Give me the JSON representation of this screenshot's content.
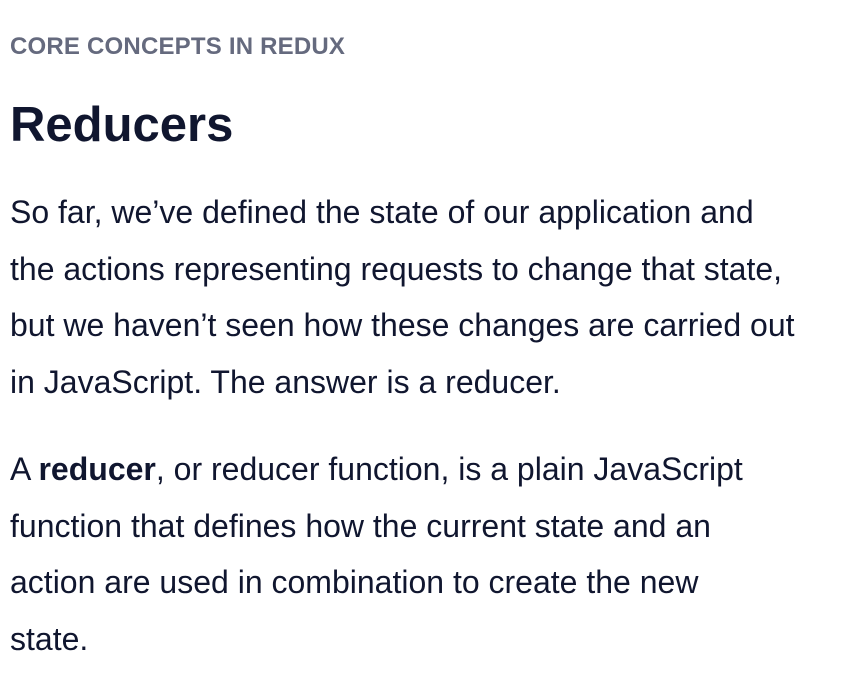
{
  "section": {
    "eyebrow": "CORE CONCEPTS IN REDUX",
    "title": "Reducers"
  },
  "paragraph_1": {
    "lines": [
      "So far, we’ve defined the state of our application and",
      "the actions representing requests to change that state,",
      "but we haven’t seen how these changes are carried out",
      "in JavaScript. The answer is a reducer."
    ]
  },
  "paragraph_2": {
    "lead": "A ",
    "term": "reducer",
    "line_1_rest": ", or reducer function, is a plain JavaScript",
    "lines": [
      "function that defines how the current state and an",
      "action are used in combination to create the new",
      "state."
    ]
  },
  "colors": {
    "text": "#10162f",
    "eyebrow": "#656a7e",
    "background": "#ffffff"
  }
}
